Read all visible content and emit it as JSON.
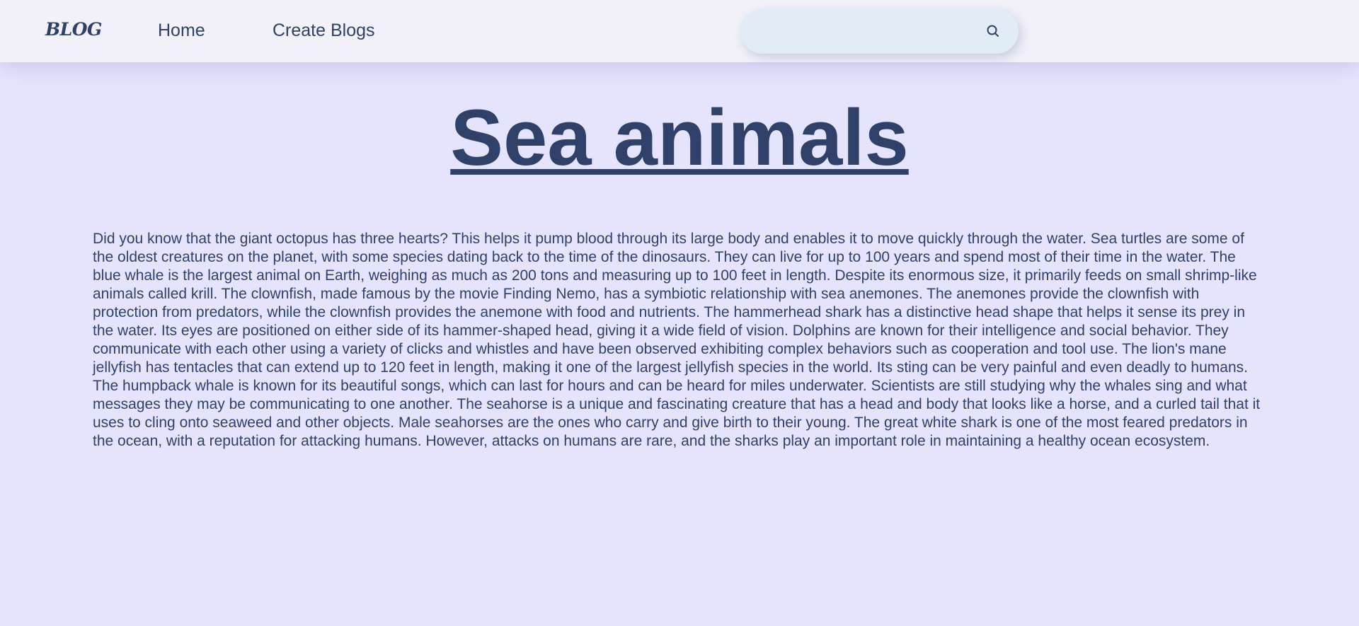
{
  "navbar": {
    "logo": "BLOG",
    "links": [
      {
        "label": "Home"
      },
      {
        "label": "Create Blogs"
      }
    ],
    "search": {
      "value": "",
      "placeholder": "",
      "icon": "search-icon"
    }
  },
  "post": {
    "title": "Sea animals",
    "body": "Did you know that the giant octopus has three hearts? This helps it pump blood through its large body and enables it to move quickly through the water. Sea turtles are some of the oldest creatures on the planet, with some species dating back to the time of the dinosaurs. They can live for up to 100 years and spend most of their time in the water. The blue whale is the largest animal on Earth, weighing as much as 200 tons and measuring up to 100 feet in length. Despite its enormous size, it primarily feeds on small shrimp-like animals called krill. The clownfish, made famous by the movie Finding Nemo, has a symbiotic relationship with sea anemones. The anemones provide the clownfish with protection from predators, while the clownfish provides the anemone with food and nutrients. The hammerhead shark has a distinctive head shape that helps it sense its prey in the water. Its eyes are positioned on either side of its hammer-shaped head, giving it a wide field of vision. Dolphins are known for their intelligence and social behavior. They communicate with each other using a variety of clicks and whistles and have been observed exhibiting complex behaviors such as cooperation and tool use. The lion's mane jellyfish has tentacles that can extend up to 120 feet in length, making it one of the largest jellyfish species in the world. Its sting can be very painful and even deadly to humans. The humpback whale is known for its beautiful songs, which can last for hours and can be heard for miles underwater. Scientists are still studying why the whales sing and what messages they may be communicating to one another. The seahorse is a unique and fascinating creature that has a head and body that looks like a horse, and a curled tail that it uses to cling onto seaweed and other objects. Male seahorses are the ones who carry and give birth to their young. The great white shark is one of the most feared predators in the ocean, with a reputation for attacking humans. However, attacks on humans are rare, and the sharks play an important role in maintaining a healthy ocean ecosystem."
  },
  "colors": {
    "background": "#e6e4fd",
    "navbar": "#f2f1f8",
    "text": "#2f4168",
    "search_bg": "#e2ecf7"
  }
}
